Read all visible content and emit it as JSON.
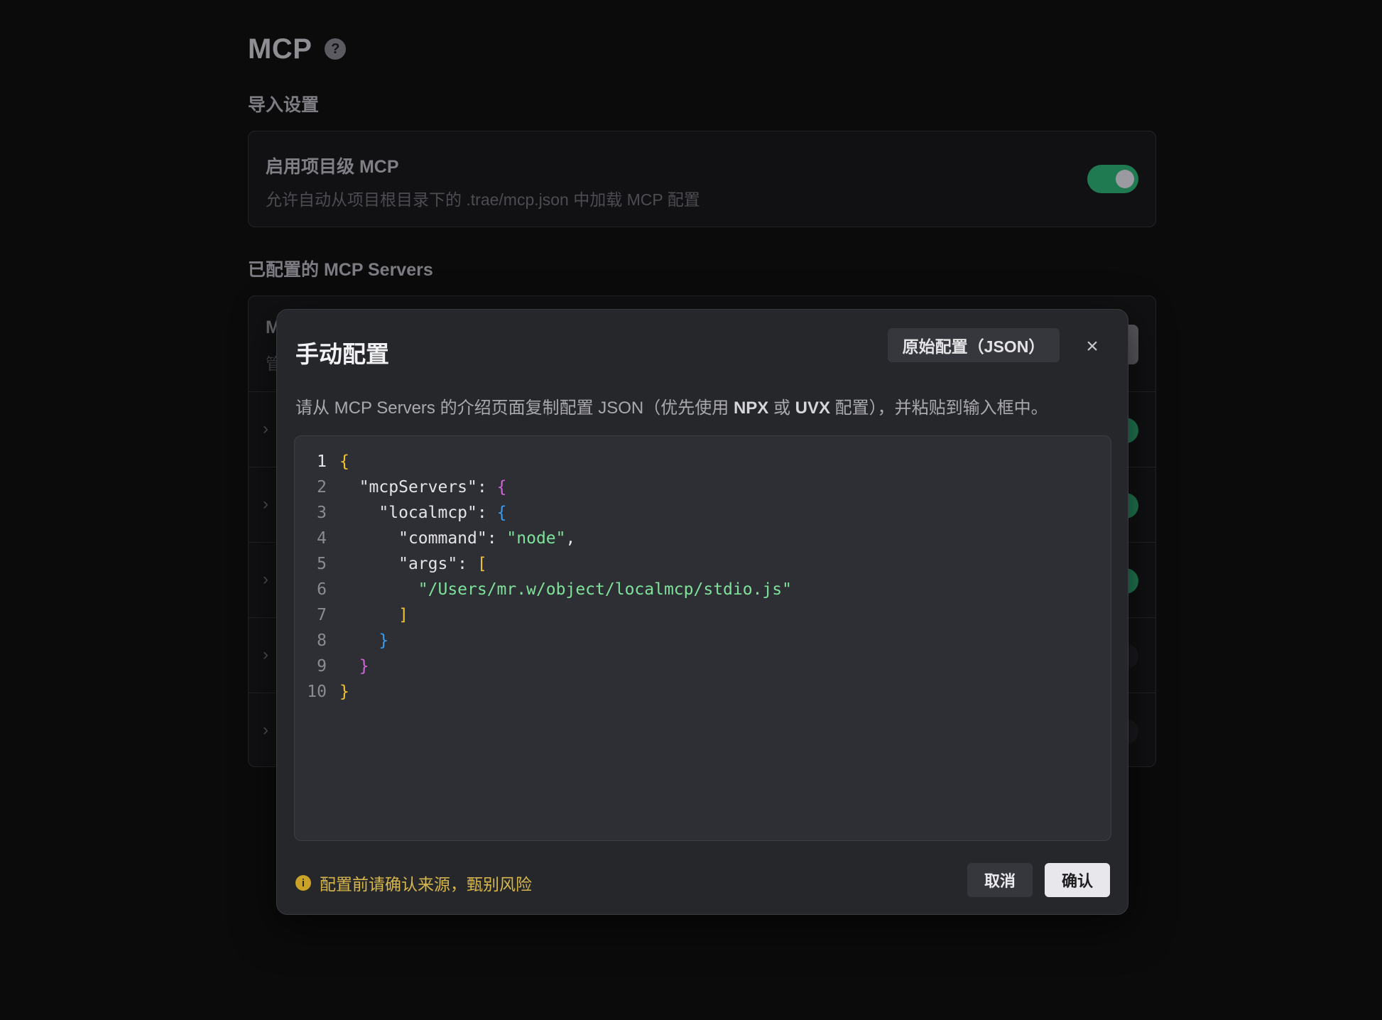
{
  "page": {
    "title": "MCP",
    "help_icon": "?",
    "import_section": "导入设置",
    "project_mcp": {
      "title": "启用项目级 MCP",
      "desc": "允许自动从项目根目录下的 .trae/mcp.json 中加载 MCP 配置",
      "enabled": true
    },
    "servers_section": "已配置的 MCP Servers",
    "servers_head": {
      "line1": "M",
      "line2": "管"
    }
  },
  "modal": {
    "title": "手动配置",
    "raw_button": "原始配置（JSON）",
    "close_icon": "×",
    "desc_parts": [
      "请从 MCP Servers 的介绍页面复制配置 JSON（优先使用 ",
      "NPX",
      " 或 ",
      "UVX",
      " 配置），并粘贴到输入框中。"
    ],
    "line_numbers": [
      "1",
      "2",
      "3",
      "4",
      "5",
      "6",
      "7",
      "8",
      "9",
      "10"
    ],
    "code": {
      "l1_open": "{",
      "l2_key": "\"mcpServers\": ",
      "l2_open": "{",
      "l3_key": "\"localmcp\": ",
      "l3_open": "{",
      "l4_key": "\"command\": ",
      "l4_val": "\"node\"",
      "l4_comma": ",",
      "l5_key": "\"args\": ",
      "l5_open": "[",
      "l6_val": "\"/Users/mr.w/object/localmcp/stdio.js\"",
      "l7_close": "]",
      "l8_close": "}",
      "l9_close": "}",
      "l10_close": "}"
    },
    "warning_icon": "i",
    "warning": "配置前请确认来源，甄别风险",
    "cancel": "取消",
    "confirm": "确认"
  },
  "colors": {
    "background": "#0b0b0c",
    "toggle_on": "#1f7a52",
    "brace_yellow": "#f1c232",
    "brace_purple": "#d066d6",
    "brace_blue": "#3b9cf0",
    "string_green": "#7ee29a",
    "warning": "#d7b74c"
  }
}
